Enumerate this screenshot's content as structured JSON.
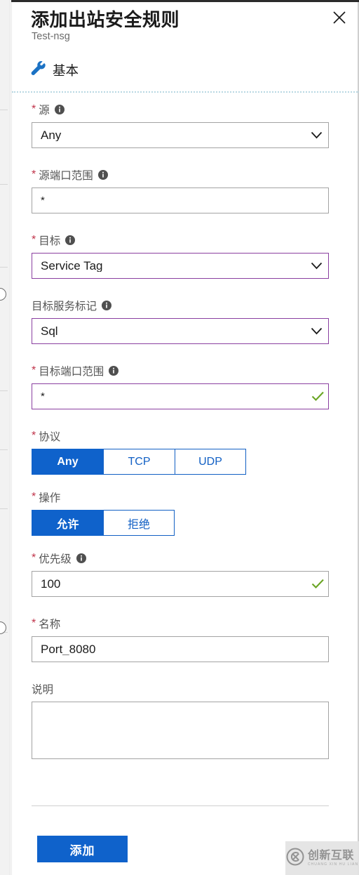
{
  "header": {
    "title": "添加出站安全规则",
    "subtitle": "Test-nsg",
    "close_icon": "close-icon"
  },
  "tab": {
    "icon": "wrench-icon",
    "label": "基本"
  },
  "form": {
    "source": {
      "label": "源",
      "required": "*",
      "info_icon": "info-icon",
      "value": "Any",
      "chevron_icon": "chevron-down-icon"
    },
    "source_port_ranges": {
      "label": "源端口范围",
      "required": "*",
      "info_icon": "info-icon",
      "value": "*"
    },
    "destination": {
      "label": "目标",
      "required": "*",
      "info_icon": "info-icon",
      "value": "Service Tag",
      "chevron_icon": "chevron-down-icon"
    },
    "destination_service_tag": {
      "label": "目标服务标记",
      "info_icon": "info-icon",
      "value": "Sql",
      "chevron_icon": "chevron-down-icon"
    },
    "destination_port_ranges": {
      "label": "目标端口范围",
      "required": "*",
      "info_icon": "info-icon",
      "value": "*",
      "valid_icon": "check-icon"
    },
    "protocol": {
      "label": "协议",
      "required": "*",
      "options": [
        "Any",
        "TCP",
        "UDP"
      ],
      "selected": "Any"
    },
    "action": {
      "label": "操作",
      "required": "*",
      "options": [
        "允许",
        "拒绝"
      ],
      "selected": "允许"
    },
    "priority": {
      "label": "优先级",
      "required": "*",
      "info_icon": "info-icon",
      "value": "100",
      "valid_icon": "check-icon"
    },
    "name": {
      "label": "名称",
      "required": "*",
      "value": "Port_8080"
    },
    "description": {
      "label": "说明",
      "value": ""
    }
  },
  "footer": {
    "submit_label": "添加"
  },
  "watermark": {
    "cn": "创新互联",
    "en": "CHUANG XIN HU LIAN",
    "logo_icon": "cx-logo-icon"
  },
  "colors": {
    "accent_blue": "#0f62cb",
    "modified_purple": "#8a3fa0",
    "required_red": "#c0334a",
    "valid_green": "#6aa524"
  }
}
